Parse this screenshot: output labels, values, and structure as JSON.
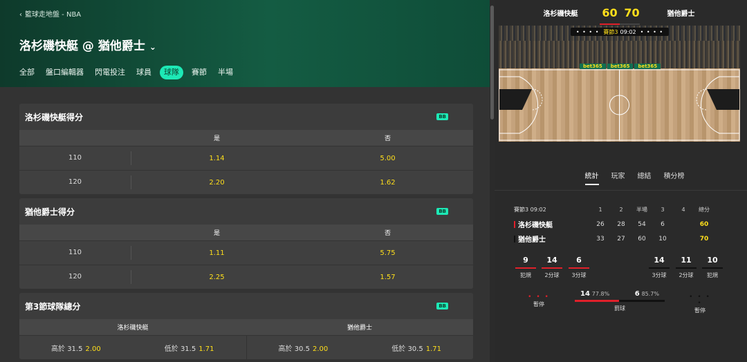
{
  "header": {
    "breadcrumb": "籃球走地盤 - NBA",
    "match_title": "洛杉磯快艇 @ 猶他爵士",
    "tabs": [
      {
        "label": "全部"
      },
      {
        "label": "盤口編輯器"
      },
      {
        "label": "閃電投注"
      },
      {
        "label": "球員"
      },
      {
        "label": "球隊",
        "active": true
      },
      {
        "label": "賽節"
      },
      {
        "label": "半場"
      }
    ]
  },
  "cards": {
    "c1": {
      "title": "洛杉磯快艇得分",
      "badge": "BB",
      "col_yes": "是",
      "col_no": "否",
      "rows": [
        {
          "line": "110",
          "yes": "1.14",
          "no": "5.00"
        },
        {
          "line": "120",
          "yes": "2.20",
          "no": "1.62"
        }
      ]
    },
    "c2": {
      "title": "猶他爵士得分",
      "badge": "BB",
      "col_yes": "是",
      "col_no": "否",
      "rows": [
        {
          "line": "110",
          "yes": "1.11",
          "no": "5.75"
        },
        {
          "line": "120",
          "yes": "2.25",
          "no": "1.57"
        }
      ]
    },
    "c3": {
      "title": "第3節球隊總分",
      "badge": "BB",
      "col_a": "洛杉磯快艇",
      "col_b": "猶他爵士",
      "cells": [
        {
          "label": "高於 31.5",
          "odds": "2.00"
        },
        {
          "label": "低於 31.5",
          "odds": "1.71"
        },
        {
          "label": "高於 30.5",
          "odds": "2.00"
        },
        {
          "label": "低於 30.5",
          "odds": "1.71"
        }
      ]
    }
  },
  "scoreboard": {
    "home": "洛杉磯快艇",
    "home_score": "60",
    "away_score": "70",
    "away": "猶他爵士"
  },
  "court": {
    "hud_dots_left": "• • • •",
    "hud_quarter": "賽節3",
    "hud_time": "09:02",
    "hud_dots_right": "• • • •",
    "ads": [
      "bet365",
      "bet365",
      "bet365"
    ]
  },
  "stat_tabs": [
    {
      "label": "統計",
      "active": true
    },
    {
      "label": "玩家"
    },
    {
      "label": "總結"
    },
    {
      "label": "積分榜"
    }
  ],
  "stats_table": {
    "period": "賽節3",
    "clock": "09:02",
    "headers": [
      "1",
      "2",
      "半場",
      "3",
      "4",
      "總分"
    ],
    "teams": [
      {
        "name": "洛杉磯快艇",
        "color": "#e0202a",
        "q1": "26",
        "q2": "28",
        "half": "54",
        "q3": "6",
        "q4": "",
        "total": "60"
      },
      {
        "name": "猶他爵士",
        "color": "#111111",
        "q1": "33",
        "q2": "27",
        "half": "60",
        "q3": "10",
        "q4": "",
        "total": "70"
      }
    ]
  },
  "team_stats": {
    "home": [
      {
        "value": "9",
        "label": "犯規"
      },
      {
        "value": "14",
        "label": "2分球"
      },
      {
        "value": "6",
        "label": "3分球"
      }
    ],
    "away": [
      {
        "value": "14",
        "label": "3分球"
      },
      {
        "value": "11",
        "label": "2分球"
      },
      {
        "value": "10",
        "label": "犯規"
      }
    ],
    "timeouts_label": "暫停",
    "home_timeouts_dots": "• • •",
    "away_timeouts_dots": "• • • •",
    "free_throws": {
      "label": "罰球",
      "home_made": "14",
      "home_pct": "77.8%",
      "away_made": "6",
      "away_pct": "85.7%"
    }
  },
  "colors": {
    "accent": "#1de9b6",
    "odds": "#ffdf1b",
    "home": "#e0202a",
    "away": "#111111"
  }
}
